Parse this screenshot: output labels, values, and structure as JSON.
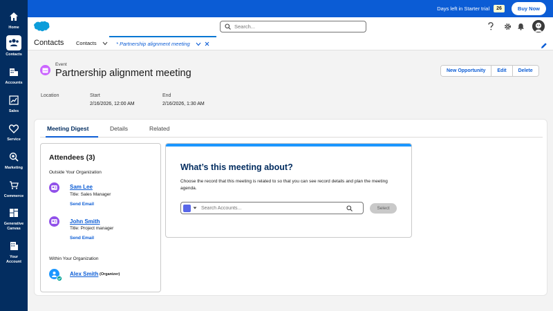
{
  "rail": {
    "items": [
      {
        "label": "Home",
        "icon": "home-icon"
      },
      {
        "label": "Contacts",
        "icon": "contacts-icon"
      },
      {
        "label": "Accounts",
        "icon": "accounts-icon"
      },
      {
        "label": "Sales",
        "icon": "sales-icon"
      },
      {
        "label": "Service",
        "icon": "service-icon"
      },
      {
        "label": "Marketing",
        "icon": "marketing-icon"
      },
      {
        "label": "Commerce",
        "icon": "commerce-icon"
      },
      {
        "label": "Generative Canvas",
        "icon": "canvas-icon"
      },
      {
        "label": "Your Account",
        "icon": "account-icon"
      }
    ]
  },
  "banner": {
    "trial_text": "Days left in Starter trial",
    "days": "26",
    "buy_label": "Buy Now"
  },
  "header": {
    "search_placeholder": "Search..."
  },
  "nav": {
    "app_name": "Contacts",
    "tab_contacts": "Contacts",
    "tab_active": "* Partnership alignment meeting"
  },
  "record": {
    "type": "Event",
    "title": "Partnership alignment meeting",
    "buttons": {
      "new_opportunity": "New Opportunity",
      "edit": "Edit",
      "delete": "Delete"
    },
    "fields": {
      "location_label": "Location",
      "start_label": "Start",
      "start_value": "2/16/2026, 12:00 AM",
      "end_label": "End",
      "end_value": "2/16/2026, 1:30 AM"
    }
  },
  "tabs": {
    "digest": "Meeting Digest",
    "details": "Details",
    "related": "Related"
  },
  "attendees": {
    "title": "Attendees (3)",
    "outside_label": "Outside Your Organization",
    "within_label": "Within Your Organization",
    "send_email": "Send Email",
    "people": [
      {
        "name": "Sam Lee",
        "title": "Title: Sales Manager"
      },
      {
        "name": "John Smith",
        "title": "Title: Project manager"
      }
    ],
    "internal": {
      "name": "Alex Smith",
      "role": "(Organizer)"
    }
  },
  "about": {
    "title": "What’s this meeting about?",
    "description": "Choose the record that this meeting is related to so that you can see record details and plan the meeting agenda.",
    "lookup_placeholder": "Search Accounts...",
    "select_label": "Select"
  },
  "colors": {
    "rail": "#032d60",
    "banner": "#0b5cd5",
    "accent": "#0b5cd5",
    "event_icon": "#cb65ff",
    "contact_icon": "#9050e9"
  }
}
